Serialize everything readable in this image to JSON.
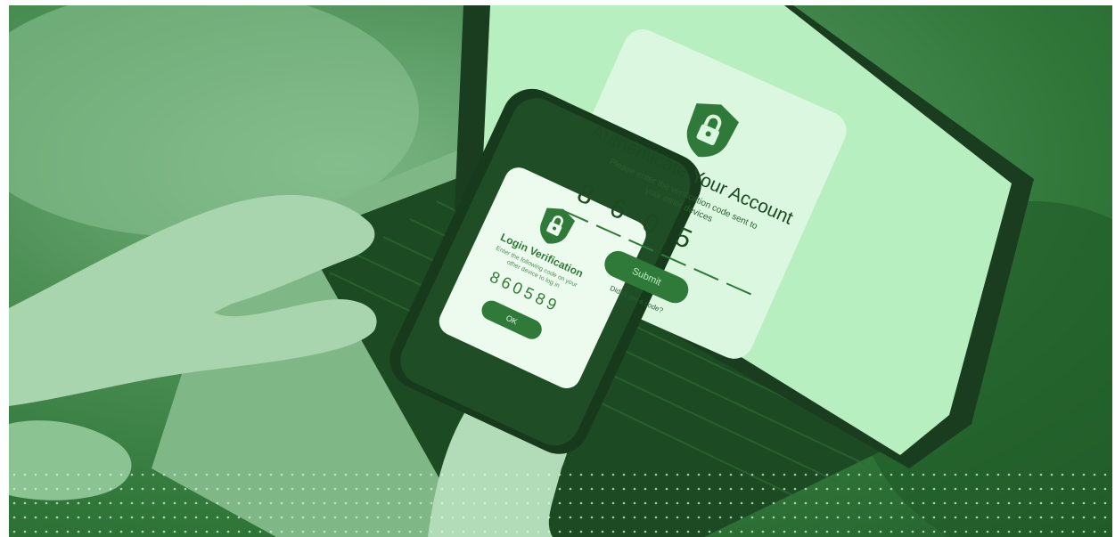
{
  "laptop_screen": {
    "title": "Authenticate Your Account",
    "subtitle_line1": "Please enter the verification code sent to",
    "subtitle_line2": "your other devices",
    "code_digits": [
      "8",
      "6",
      "0",
      "5",
      "",
      ""
    ],
    "submit_label": "Submit",
    "resend_label": "Didn't get a code?"
  },
  "phone_screen": {
    "title": "Login Verification",
    "message_line1": "Enter the following code on your",
    "message_line2": "other device to log in",
    "code": "860589",
    "ok_label": "OK"
  },
  "icons": [
    "shield-lock-icon"
  ],
  "colors": {
    "tint_dark": "#235f2b",
    "tint_mid": "#4e9157",
    "screen_light": "#b8efc0",
    "card_light": "#dcf7df",
    "accent": "#2f7a39"
  }
}
